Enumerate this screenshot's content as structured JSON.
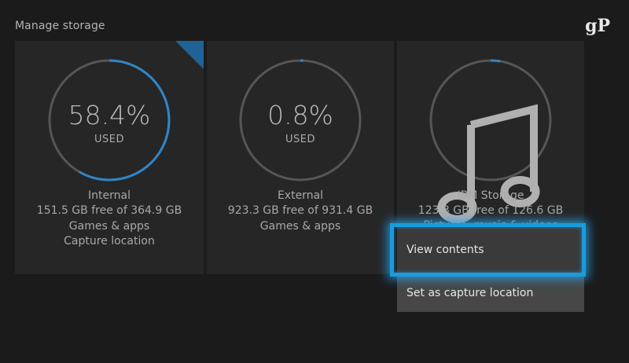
{
  "page": {
    "title": "Manage storage",
    "logo": "gP"
  },
  "colors": {
    "ring_track": "#565656",
    "ring_fill": "#2e86c9",
    "focus": "#1a9bdc"
  },
  "tiles": [
    {
      "percent_text": "58.4%",
      "used_label": "USED",
      "used_fraction": 0.584,
      "name": "Internal",
      "free": "151.5 GB free of 364.9 GB",
      "line3": "Games & apps",
      "line4": "Capture location",
      "selected": true
    },
    {
      "percent_text": "0.8%",
      "used_label": "USED",
      "used_fraction": 0.008,
      "name": "External",
      "free": "923.3 GB free of 931.4 GB",
      "line3": "Games & apps"
    },
    {
      "icon": "music-note-icon",
      "used_fraction": 0.026,
      "name": "IBM Storage",
      "free": "123.3 GB free of 126.6 GB",
      "line3_partial": "Pictures, music & videos"
    }
  ],
  "context_menu": {
    "items": [
      {
        "label": "View contents",
        "focused": true
      },
      {
        "label": "Set as capture location",
        "focused": false
      }
    ]
  }
}
